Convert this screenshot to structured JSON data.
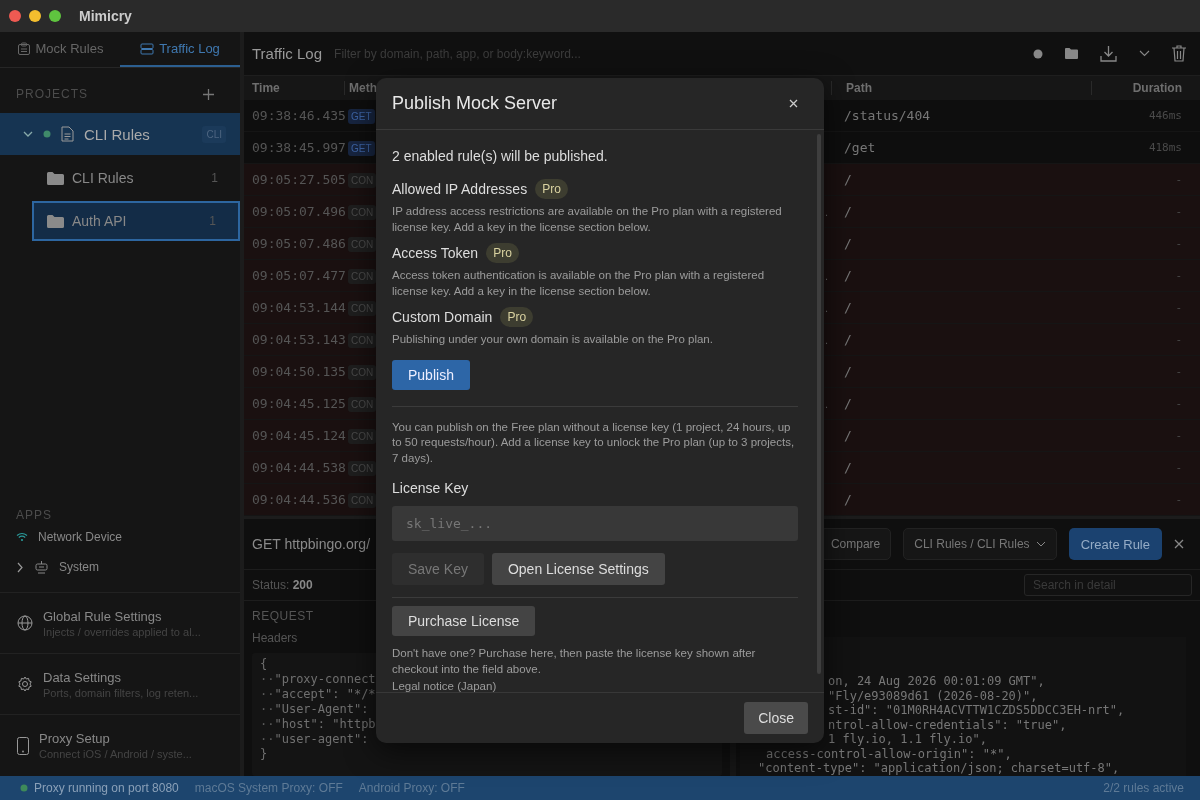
{
  "window": {
    "title": "Mimicry"
  },
  "sidebar": {
    "tabs": [
      {
        "label": "Mock Rules",
        "kind": "rules",
        "selected": false
      },
      {
        "label": "Traffic Log",
        "kind": "log",
        "selected": true
      }
    ],
    "projects_heading": "PROJECTS",
    "projects": [
      {
        "name": "CLI Rules",
        "tag": "CLI",
        "expanded": true,
        "selected": true,
        "children": [
          {
            "name": "CLI Rules",
            "count": "1",
            "selected": false
          },
          {
            "name": "Auth API",
            "count": "1",
            "selected": true
          }
        ]
      }
    ],
    "apps_heading": "APPS",
    "apps": [
      {
        "name": "Network Device",
        "kind": "network"
      },
      {
        "name": "System",
        "kind": "system"
      }
    ],
    "settings": [
      {
        "title": "Global Rule Settings",
        "subtitle": "Injects / overrides applied to al...",
        "kind": "globe"
      },
      {
        "title": "Data Settings",
        "subtitle": "Ports, domain filters, log reten...",
        "kind": "gear"
      },
      {
        "title": "Proxy Setup",
        "subtitle": "Connect iOS / Android / syste...",
        "kind": "phone"
      }
    ]
  },
  "traffic_log": {
    "title": "Traffic Log",
    "filter": {
      "placeholder": "Filter by domain, path, app, or body:keyword..."
    },
    "columns": [
      "Time",
      "Meth",
      "Path",
      "Duration"
    ],
    "rows": [
      {
        "time": "09:38:46.435",
        "method": "GET",
        "path": "/status/404",
        "duration": "446ms",
        "failed": false
      },
      {
        "time": "09:38:45.997",
        "method": "GET",
        "path": "/get",
        "duration": "418ms",
        "failed": false
      },
      {
        "time": "09:05:27.505",
        "method": "CON",
        "path": "/",
        "duration": "-",
        "failed": true
      },
      {
        "time": "09:05:07.496",
        "method": "CON",
        "column_3": "..",
        "path": "/",
        "duration": "-",
        "failed": true
      },
      {
        "time": "09:05:07.486",
        "method": "CON",
        "path": "/",
        "duration": "-",
        "failed": true
      },
      {
        "time": "09:05:07.477",
        "method": "CON",
        "column_3": "..",
        "path": "/",
        "duration": "-",
        "failed": true
      },
      {
        "time": "09:04:53.144",
        "method": "CON",
        "column_3": "..",
        "path": "/",
        "duration": "-",
        "failed": true
      },
      {
        "time": "09:04:53.143",
        "method": "CON",
        "column_3": "..",
        "path": "/",
        "duration": "-",
        "failed": true
      },
      {
        "time": "09:04:50.135",
        "method": "CON",
        "path": "/",
        "duration": "-",
        "failed": true
      },
      {
        "time": "09:04:45.125",
        "method": "CON",
        "column_3": "..",
        "path": "/",
        "duration": "-",
        "failed": true
      },
      {
        "time": "09:04:45.124",
        "method": "CON",
        "path": "/",
        "duration": "-",
        "failed": true
      },
      {
        "time": "09:04:44.538",
        "method": "CON",
        "path": "/",
        "duration": "-",
        "failed": true
      },
      {
        "time": "09:04:44.536",
        "method": "CON",
        "path": "/",
        "duration": "-",
        "failed": true
      }
    ]
  },
  "detail": {
    "title": "GET httpbingo.org/",
    "compare": "Compare",
    "target": "CLI Rules / CLI Rules",
    "create": "Create Rule",
    "status_label": "Status:",
    "status": "200",
    "search": {
      "placeholder": "Search in detail"
    },
    "request_heading": "REQUEST",
    "headers_heading": "Headers",
    "request_lines": [
      {
        "text": "{"
      },
      {
        "indent": "··",
        "text": "\"proxy-connect"
      },
      {
        "indent": "··",
        "text": "\"accept\": \"*/*"
      },
      {
        "indent": "··",
        "text": "\"User-Agent\":"
      },
      {
        "indent": "··",
        "text": "\"host\": \"httpb"
      },
      {
        "indent": "··",
        "text": "\"user-agent\":"
      },
      {
        "text": "}"
      }
    ],
    "response_lines": [
      {
        "kind": "cut-wide",
        "text": "on, 24 Aug 2026 00:01:09 GMT\","
      },
      {
        "kind": "cut-wide",
        "text": "\"Fly/e93089d61 (2026-08-20)\","
      },
      {
        "kind": "cut-wide",
        "text": "st-id\": \"01M0RH4ACVTTW1CZDS5DDCC3EH-nrt\","
      },
      {
        "kind": "cut-wide",
        "text": "ntrol-allow-credentials\": \"true\","
      },
      {
        "kind": "cut-wide",
        "text": "1 fly.io, 1.1 fly.io\","
      },
      {
        "kind": "cut-narrow",
        "text": "access-control-allow-origin\": \"*\","
      },
      {
        "kind": "whole",
        "text": "\"content-type\": \"application/json; charset=utf-8\","
      }
    ]
  },
  "dialog": {
    "title": "Publish Mock Server",
    "summary": "2 enabled rule(s) will be published.",
    "features": [
      {
        "title": "Allowed IP Addresses",
        "badge": "Pro",
        "description": "IP address access restrictions are available on the Pro plan with a registered license key. Add a key in the license section below."
      },
      {
        "title": "Access Token",
        "badge": "Pro",
        "description": "Access token authentication is available on the Pro plan with a registered license key. Add a key in the license section below."
      },
      {
        "title": "Custom Domain",
        "badge": "Pro",
        "description": "Publishing under your own domain is available on the Pro plan."
      }
    ],
    "publish": "Publish",
    "free_plan_note": "You can publish on the Free plan without a license key (1 project, 24 hours, up to 50 requests/hour). Add a license key to unlock the Pro plan (up to 3 projects, 7 days).",
    "license_heading": "License Key",
    "license_field": {
      "placeholder": "sk_live_..."
    },
    "save_key": {
      "label": "Save Key",
      "disabled": true
    },
    "open_settings": "Open License Settings",
    "purchase": "Purchase License",
    "purchase_note": "Don't have one? Purchase here, then paste the license key shown after checkout into the field above.",
    "legal_link": "Legal notice (Japan)",
    "close": "Close"
  },
  "status_bar": {
    "proxy": "Proxy running on port 8080",
    "running": true,
    "macos": "macOS System Proxy: OFF",
    "android": "Android Proxy: OFF",
    "rules": "2/2 rules active"
  }
}
